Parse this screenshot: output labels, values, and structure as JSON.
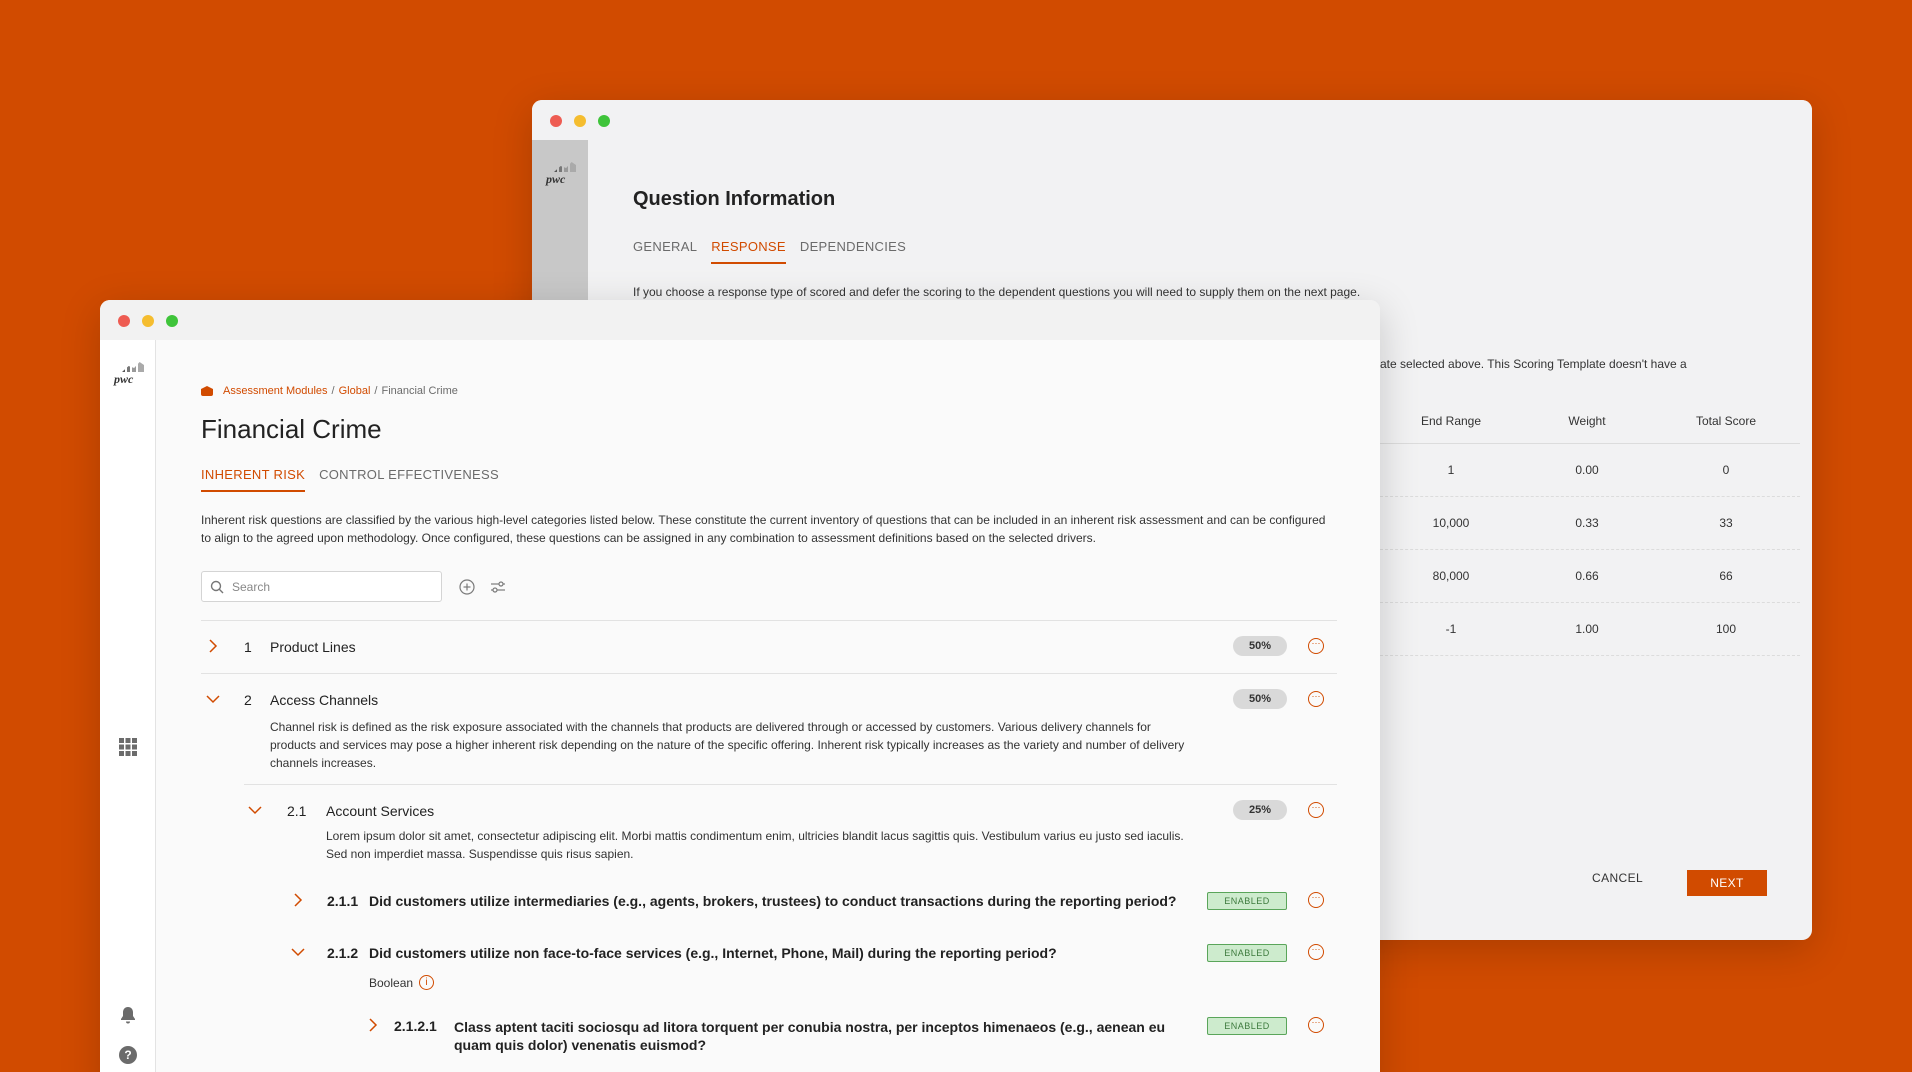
{
  "back_window": {
    "logo": "pwc",
    "title": "Question Information",
    "tabs": [
      {
        "label": "GENERAL",
        "active": false
      },
      {
        "label": "RESPONSE",
        "active": true
      },
      {
        "label": "DEPENDENCIES",
        "active": false
      }
    ],
    "hint": "If you choose a response type of scored and defer the scoring to the dependent questions you will need to supply them on the next page.",
    "hint2": "ate selected above. This Scoring Template doesn't have a",
    "scoring_table": {
      "columns": [
        "End Range",
        "Weight",
        "Total Score"
      ],
      "rows": [
        [
          "1",
          "0.00",
          "0"
        ],
        [
          "10,000",
          "0.33",
          "33"
        ],
        [
          "80,000",
          "0.66",
          "66"
        ],
        [
          "-1",
          "1.00",
          "100"
        ]
      ]
    },
    "cancel_label": "CANCEL",
    "next_label": "NEXT"
  },
  "front_window": {
    "logo": "pwc",
    "breadcrumb": {
      "parts": [
        "Assessment Modules",
        "Global"
      ],
      "current": "Financial Crime"
    },
    "title": "Financial Crime",
    "tabs": [
      {
        "label": "INHERENT RISK",
        "active": true
      },
      {
        "label": "CONTROL EFFECTIVENESS",
        "active": false
      }
    ],
    "description": "Inherent risk questions are classified by the various high-level categories listed below. These constitute the current inventory of questions that can be included in an inherent risk assessment and can be configured to align to the agreed upon methodology. Once configured, these questions can be assigned in any combination to assessment definitions based on the selected drivers.",
    "search_placeholder": "Search",
    "tree": {
      "product_lines": {
        "num": "1",
        "label": "Product Lines",
        "pct": "50%"
      },
      "access_channels": {
        "num": "2",
        "label": "Access Channels",
        "pct": "50%",
        "desc": "Channel risk is defined as the risk exposure associated with the channels that products are delivered through or accessed by customers. Various delivery channels for products and services may pose a higher inherent risk depending on the nature of the specific offering. Inherent risk typically increases as the variety and number of delivery channels increases."
      },
      "account_services": {
        "num": "2.1",
        "label": "Account Services",
        "pct": "25%",
        "desc": "Lorem ipsum dolor sit amet, consectetur adipiscing elit. Morbi mattis condimentum enim, ultricies blandit lacus sagittis quis. Vestibulum varius eu justo sed iaculis. Sed non imperdiet massa. Suspendisse quis risus sapien."
      },
      "q211": {
        "num": "2.1.1",
        "label": "Did customers utilize intermediaries (e.g., agents, brokers, trustees) to conduct transactions during the reporting period?",
        "status": "ENABLED"
      },
      "q212": {
        "num": "2.1.2",
        "label": "Did customers utilize non face-to-face services (e.g., Internet, Phone, Mail) during the reporting period?",
        "status": "ENABLED",
        "type": "Boolean"
      },
      "q2121": {
        "num": "2.1.2.1",
        "label": "Class aptent taciti sociosqu ad litora torquent per conubia nostra, per inceptos himenaeos (e.g., aenean eu quam quis dolor) venenatis euismod?",
        "status": "ENABLED"
      }
    }
  }
}
